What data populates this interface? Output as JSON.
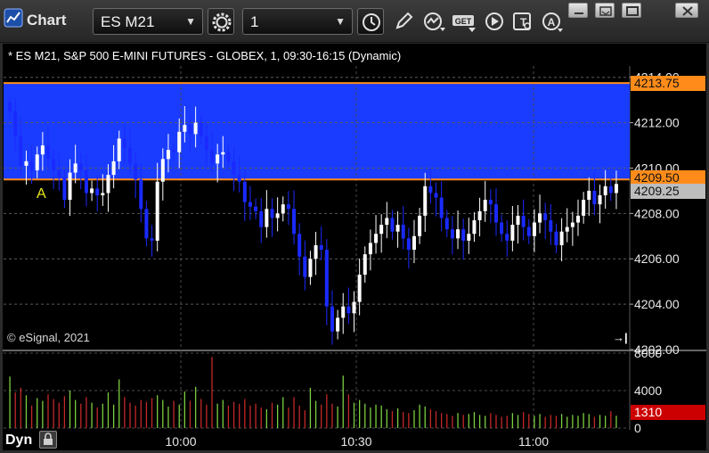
{
  "toolbar": {
    "title": "Chart",
    "symbol_value": "ES M21",
    "interval_value": "1",
    "get_label": "GET"
  },
  "chart_header": {
    "description": "* ES M21, S&P 500 E-MINI FUTURES - GLOBEX, 1, 09:30-16:15 (Dynamic)",
    "copyright": "© eSignal, 2021",
    "annotation_letter": "A"
  },
  "price_tags": {
    "upper_zone": "4213.75",
    "lower_zone": "4209.50",
    "last_price": "4209.25",
    "volume": "1310"
  },
  "bottom": {
    "mode_label": "Dyn"
  },
  "colors": {
    "zone_fill": "#1a3cff",
    "zone_line": "#ff8c1a",
    "up_bar": "#ffffff",
    "down_bar": "#1a2aff",
    "volume_up": "#7ccf3f",
    "volume_down": "#c42828",
    "volume_tag": "#cc0000",
    "annotation": "#e8e81a"
  },
  "chart_data": [
    {
      "type": "candlestick",
      "title": "",
      "price_ticks": [
        "4214.00",
        "4212.00",
        "4210.00",
        "4208.00",
        "4206.00",
        "4204.00",
        "4202.00"
      ],
      "ylim": [
        4202,
        4214.5
      ],
      "time_ticks": [
        "10:00",
        "10:30",
        "11:00"
      ],
      "zone": {
        "top": 4213.75,
        "bottom": 4209.5
      },
      "last_price": 4209.25,
      "closes": [
        4212.5,
        4211.4,
        4210.1,
        4210.3,
        4209.9,
        4210.6,
        4211.0,
        4210.4,
        4209.9,
        4209.6,
        4208.6,
        4209.8,
        4210.2,
        4209.9,
        4208.9,
        4209.1,
        4208.8,
        4208.9,
        4209.7,
        4210.3,
        4211.3,
        4210.9,
        4210.2,
        4209.5,
        4208.2,
        4206.9,
        4206.8,
        4209.4,
        4210.4,
        4210.8,
        4210.7,
        4211.6,
        4211.9,
        4211.5,
        4212.0,
        4211.4,
        4210.8,
        4210.2,
        4210.6,
        4210.7,
        4210.3,
        4209.7,
        4209.4,
        4208.5,
        4208.3,
        4208.1,
        4207.4,
        4208.2,
        4207.8,
        4208.0,
        4208.4,
        4208.2,
        4207.1,
        4206.1,
        4205.2,
        4206.0,
        4206.6,
        4206.4,
        4203.9,
        4202.8,
        4203.4,
        4203.9,
        4203.6,
        4204.1,
        4205.3,
        4206.2,
        4206.7,
        4207.1,
        4207.5,
        4207.8,
        4207.2,
        4207.5,
        4206.9,
        4206.4,
        4207.0,
        4207.9,
        4209.2,
        4208.9,
        4208.7,
        4207.8,
        4207.3,
        4206.9,
        4207.3,
        4206.8,
        4207.1,
        4207.7,
        4208.1,
        4208.6,
        4208.4,
        4207.6,
        4207.1,
        4206.8,
        4207.5,
        4207.9,
        4207.4,
        4207.0,
        4207.6,
        4208.0,
        4207.7,
        4207.2,
        4206.6,
        4207.2,
        4207.4,
        4207.6,
        4207.9,
        4208.6,
        4209.0,
        4208.4,
        4208.8,
        4209.2,
        4208.9,
        4209.3
      ],
      "volume_axis_ticks": [
        "8000",
        "4000",
        "0"
      ],
      "volume_ylim": [
        0,
        8000
      ],
      "volumes": [
        5500,
        3800,
        4300,
        3500,
        2400,
        3200,
        2900,
        3600,
        3100,
        2700,
        3400,
        4000,
        3000,
        2600,
        3300,
        2700,
        2200,
        2600,
        3800,
        2500,
        5200,
        3300,
        2700,
        2400,
        3000,
        2800,
        3200,
        3500,
        3000,
        2300,
        2900,
        2500,
        3900,
        2900,
        4400,
        3100,
        2500,
        7600,
        2600,
        3000,
        2400,
        2800,
        2600,
        3100,
        2400,
        2600,
        2200,
        2000,
        2700,
        2500,
        3300,
        2200,
        3300,
        2400,
        1900,
        4300,
        2900,
        2500,
        3600,
        2600,
        2300,
        5600,
        3600,
        2700,
        3000,
        2600,
        2200,
        2500,
        2400,
        2000,
        1800,
        2100,
        1700,
        1600,
        1900,
        2500,
        2300,
        2000,
        1800,
        1600,
        1500,
        1300,
        1600,
        1400,
        1500,
        1700,
        1400,
        1300,
        1600,
        1400,
        1200,
        1300,
        1600,
        1400,
        1700,
        1500,
        1300,
        1500,
        1200,
        1400,
        1300,
        1500,
        1200,
        1400,
        1300,
        1600,
        1500,
        1200,
        1400,
        1300,
        1800,
        1310
      ]
    }
  ]
}
